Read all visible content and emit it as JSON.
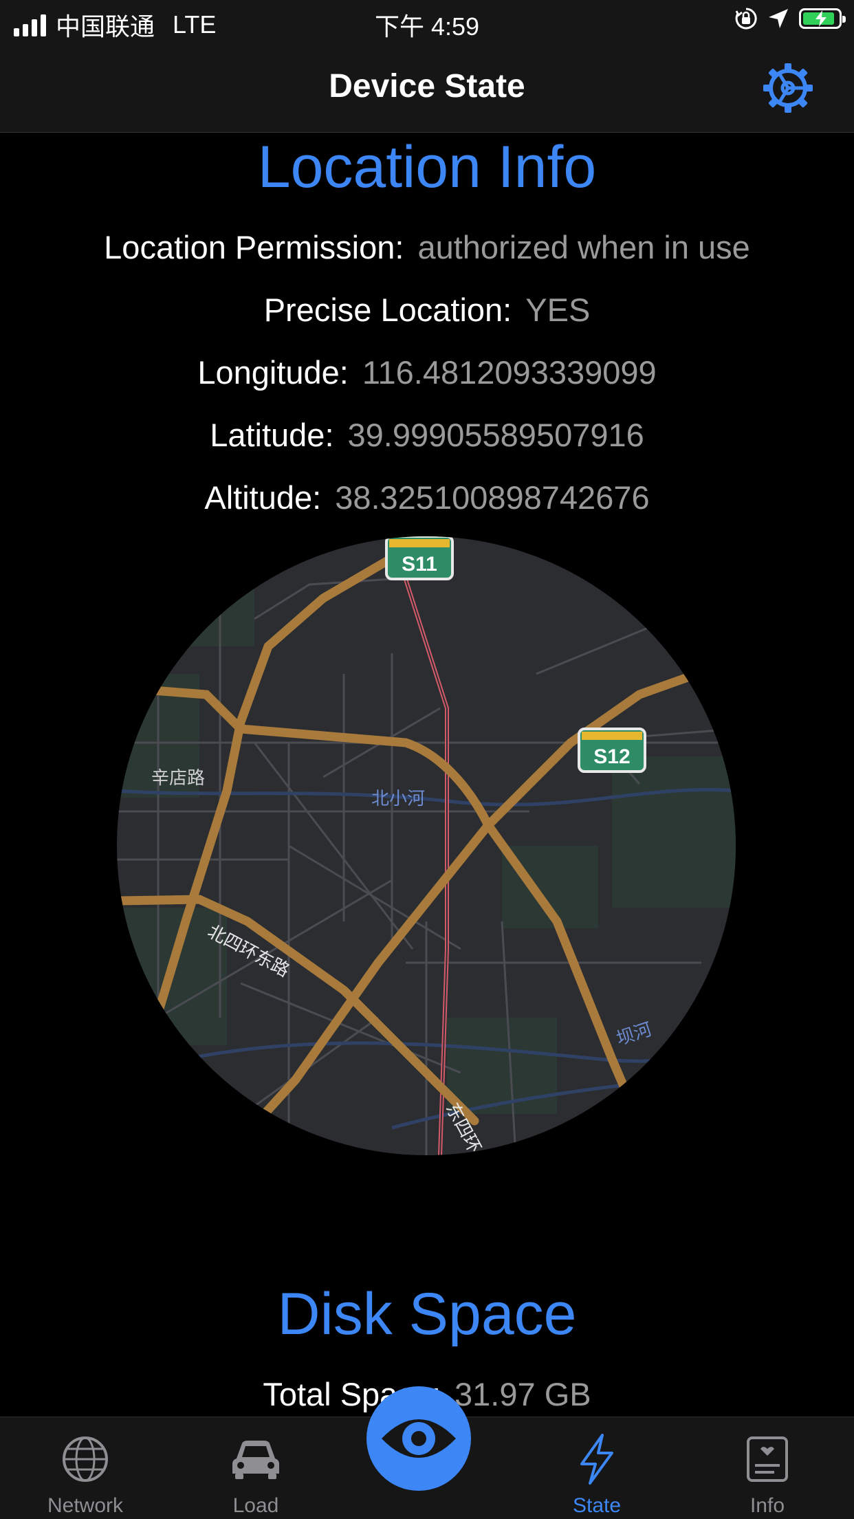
{
  "status_bar": {
    "carrier": "中国联通",
    "network": "LTE",
    "time": "下午 4:59"
  },
  "nav": {
    "title": "Device State"
  },
  "location_section": {
    "title": "Location Info",
    "rows": [
      {
        "label": "Location Permission:",
        "value": "authorized when in use"
      },
      {
        "label": "Precise Location:",
        "value": "YES"
      },
      {
        "label": "Longitude:",
        "value": "116.4812093339099"
      },
      {
        "label": "Latitude:",
        "value": "39.99905589507916"
      },
      {
        "label": "Altitude:",
        "value": "38.325100898742676"
      }
    ]
  },
  "map": {
    "labels": {
      "s11": "S11",
      "s12": "S12",
      "xindian_road": "辛店路",
      "beixiaohe": "北小河",
      "north_4th_ring_east": "北四环东路",
      "bahe": "坝河",
      "dongsi": "东四环"
    }
  },
  "disk_section": {
    "title": "Disk Space",
    "total_label": "Total Space:",
    "total_value": "31.97 GB"
  },
  "tab_bar": {
    "tabs": [
      {
        "label": "Network",
        "icon": "globe-icon"
      },
      {
        "label": "Load",
        "icon": "car-icon"
      },
      {
        "label": "",
        "icon": "eye-icon"
      },
      {
        "label": "State",
        "icon": "bolt-icon"
      },
      {
        "label": "Info",
        "icon": "id-card-icon"
      }
    ],
    "active": "State"
  },
  "colors": {
    "accent": "#3d86f5",
    "road": "#a87a3c",
    "value_gray": "#9a9a9a"
  }
}
